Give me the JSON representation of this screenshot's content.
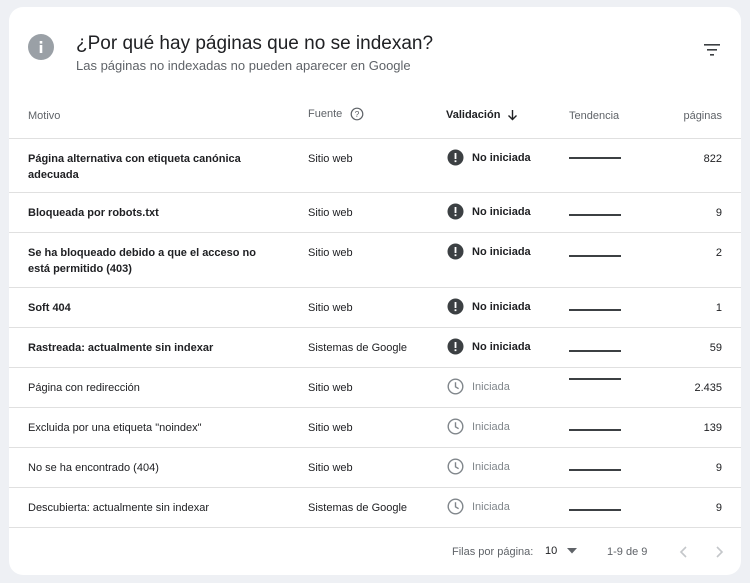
{
  "header": {
    "title": "¿Por qué hay páginas que no se indexan?",
    "subtitle": "Las páginas no indexadas no pueden aparecer en Google",
    "icon": "info-icon",
    "filter_icon": "filter-icon"
  },
  "columns": {
    "motivo": "Motivo",
    "fuente": "Fuente",
    "validacion": "Validación",
    "tendencia": "Tendencia",
    "paginas": "páginas"
  },
  "rows": [
    {
      "motivo": "Página alternativa con etiqueta canónica adecuada",
      "fuente": "Sitio web",
      "validacion": "No iniciada",
      "status": "error",
      "paginas": "822"
    },
    {
      "motivo": "Bloqueada por robots.txt",
      "fuente": "Sitio web",
      "validacion": "No iniciada",
      "status": "error",
      "paginas": "9"
    },
    {
      "motivo": "Se ha bloqueado debido a que el acceso no está permitido (403)",
      "fuente": "Sitio web",
      "validacion": "No iniciada",
      "status": "error",
      "paginas": "2"
    },
    {
      "motivo": "Soft 404",
      "fuente": "Sitio web",
      "validacion": "No iniciada",
      "status": "error",
      "paginas": "1"
    },
    {
      "motivo": "Rastreada: actualmente sin indexar",
      "fuente": "Sistemas de Google",
      "validacion": "No iniciada",
      "status": "error",
      "paginas": "59"
    },
    {
      "motivo": "Página con redirección",
      "fuente": "Sitio web",
      "validacion": "Iniciada",
      "status": "pending",
      "paginas": "2.435"
    },
    {
      "motivo": "Excluida por una etiqueta \"noindex\"",
      "fuente": "Sitio web",
      "validacion": "Iniciada",
      "status": "pending",
      "paginas": "139"
    },
    {
      "motivo": "No se ha encontrado (404)",
      "fuente": "Sitio web",
      "validacion": "Iniciada",
      "status": "pending",
      "paginas": "9"
    },
    {
      "motivo": "Descubierta: actualmente sin indexar",
      "fuente": "Sistemas de Google",
      "validacion": "Iniciada",
      "status": "pending",
      "paginas": "9"
    }
  ],
  "footer": {
    "rows_per_page_label": "Filas por página:",
    "rows_per_page_value": "10",
    "range": "1-9 de 9"
  },
  "colors": {
    "error_icon": "#3c4043",
    "pending_icon": "#80868b",
    "trend_line": "#3c4043",
    "background": "#eef0f4"
  }
}
